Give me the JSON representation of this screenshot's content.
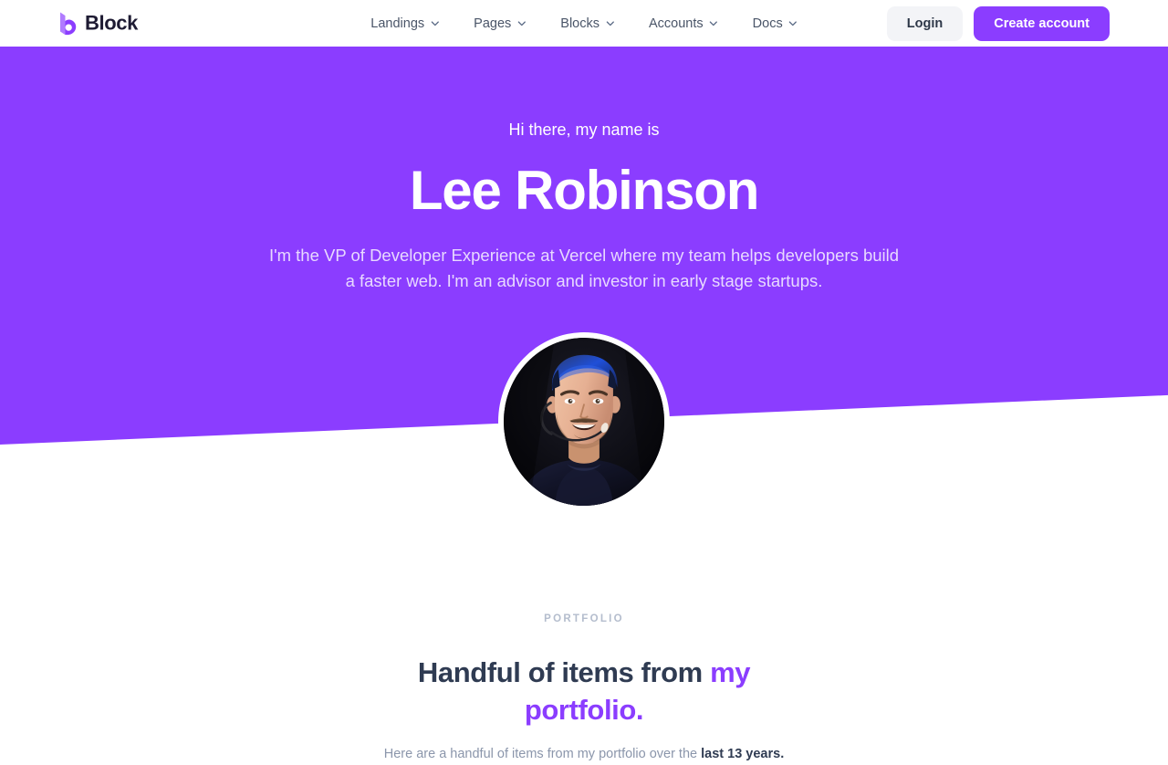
{
  "header": {
    "brand": {
      "name": "Block",
      "mark_icon": "block-logo-icon",
      "color": "#8B3DFF"
    },
    "nav": [
      {
        "label": "Landings",
        "icon": "chevron-down-icon"
      },
      {
        "label": "Pages",
        "icon": "chevron-down-icon"
      },
      {
        "label": "Blocks",
        "icon": "chevron-down-icon"
      },
      {
        "label": "Accounts",
        "icon": "chevron-down-icon"
      },
      {
        "label": "Docs",
        "icon": "chevron-down-icon"
      }
    ],
    "login_label": "Login",
    "create_account_label": "Create account"
  },
  "hero": {
    "greeting": "Hi there, my name is",
    "name": "Lee Robinson",
    "subtitle": "I'm the VP of Developer Experience at Vercel where my team helps developers build a faster web. I'm an advisor and investor in early stage startups.",
    "background_color": "#8B3DFF",
    "avatar_alt": "portrait-photo"
  },
  "portfolio": {
    "eyebrow": "PORTFOLIO",
    "title_plain": "Handful of items from ",
    "title_accent": "my portfolio.",
    "description_plain": "Here are a handful of items from my portfolio over the ",
    "description_strong": "last 13 years.",
    "accent_color": "#8B3DFF"
  }
}
